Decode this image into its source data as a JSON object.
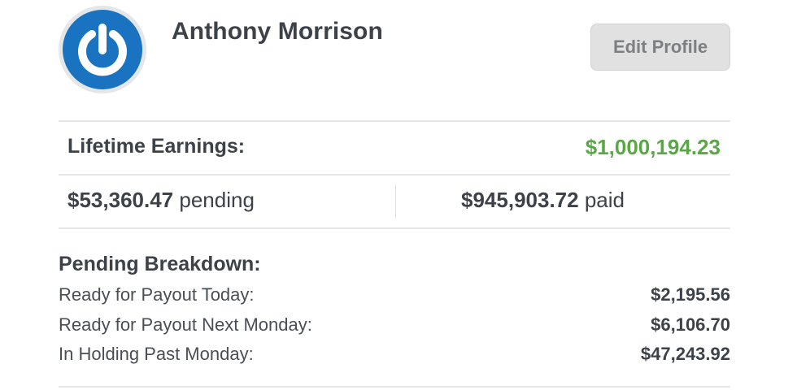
{
  "profile": {
    "name": "Anthony Morrison",
    "edit_label": "Edit Profile",
    "avatar_icon": "power-icon"
  },
  "earnings": {
    "lifetime_label": "Lifetime Earnings:",
    "lifetime_value": "$1,000,194.23",
    "pending_amount": "$53,360.47",
    "pending_word": "pending",
    "paid_amount": "$945,903.72",
    "paid_word": "paid"
  },
  "breakdown": {
    "title": "Pending Breakdown:",
    "rows": [
      {
        "label": "Ready for Payout Today:",
        "value": "$2,195.56"
      },
      {
        "label": "Ready for Payout Next Monday:",
        "value": "$6,106.70"
      },
      {
        "label": "In Holding Past Monday:",
        "value": "$47,243.92"
      }
    ]
  },
  "colors": {
    "accent_green": "#5aa845",
    "avatar_blue": "#1a73c1",
    "text_dark": "#3d4148",
    "button_bg": "#e1e1e1"
  }
}
